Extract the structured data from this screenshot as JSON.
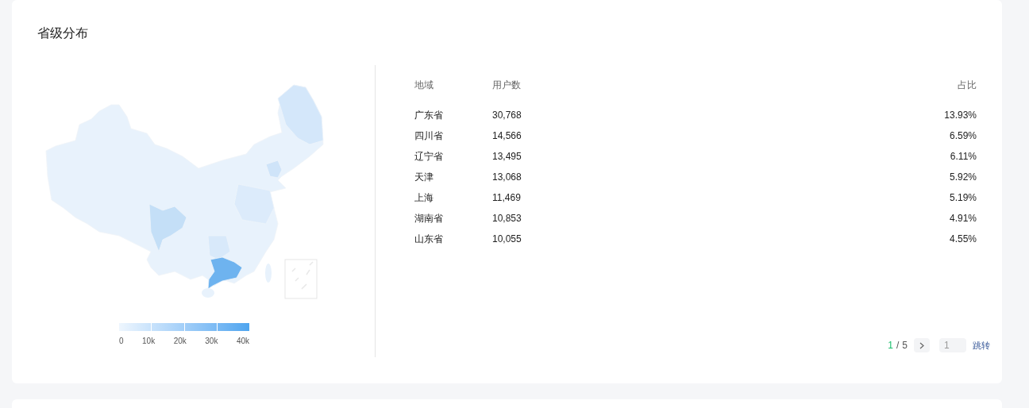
{
  "title": "省级分布",
  "legend": {
    "ticks": [
      "0",
      "10k",
      "20k",
      "30k",
      "40k"
    ]
  },
  "table": {
    "columns": [
      "地域",
      "用户数",
      "占比"
    ],
    "rows": [
      {
        "region": "广东省",
        "users": "30,768",
        "share": "13.93%"
      },
      {
        "region": "四川省",
        "users": "14,566",
        "share": "6.59%"
      },
      {
        "region": "辽宁省",
        "users": "13,495",
        "share": "6.11%"
      },
      {
        "region": "天津",
        "users": "13,068",
        "share": "5.92%"
      },
      {
        "region": "上海",
        "users": "11,469",
        "share": "5.19%"
      },
      {
        "region": "湖南省",
        "users": "10,853",
        "share": "4.91%"
      },
      {
        "region": "山东省",
        "users": "10,055",
        "share": "4.55%"
      }
    ]
  },
  "pagination": {
    "current": "1",
    "separator": "/",
    "total": "5",
    "page_input_placeholder": "1",
    "jump_label": "跳转"
  }
}
